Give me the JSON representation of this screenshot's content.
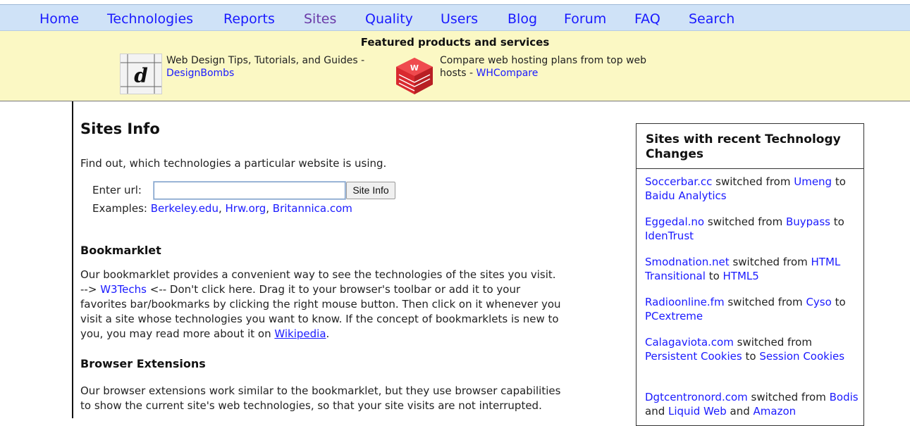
{
  "nav": {
    "items": [
      {
        "label": "Home",
        "active": false
      },
      {
        "label": "Technologies",
        "active": false
      },
      {
        "label": "Reports",
        "active": false
      },
      {
        "label": "Sites",
        "active": true
      },
      {
        "label": "Quality",
        "active": false
      },
      {
        "label": "Users",
        "active": false
      },
      {
        "label": "Blog",
        "active": false
      },
      {
        "label": "Forum",
        "active": false
      },
      {
        "label": "FAQ",
        "active": false
      },
      {
        "label": "Search",
        "active": false
      }
    ]
  },
  "featured": {
    "title": "Featured products and services",
    "items": [
      {
        "text": "Web Design Tips, Tutorials, and Guides -",
        "link": "DesignBombs",
        "icon": "designbombs-logo-icon"
      },
      {
        "text": "Compare web hosting plans from top web hosts -",
        "link": "WHCompare",
        "icon": "whcompare-logo-icon"
      }
    ]
  },
  "main": {
    "title": "Sites Info",
    "intro": "Find out, which technologies a particular website is using.",
    "url_label": "Enter url:",
    "url_value": "",
    "url_placeholder": "",
    "submit_label": "Site Info",
    "examples_label": "Examples:",
    "examples": [
      "Berkeley.edu",
      "Hrw.org",
      "Britannica.com"
    ],
    "bookmarklet": {
      "heading": "Bookmarklet",
      "line1": "Our bookmarklet provides a convenient way to see the technologies of the sites you visit.",
      "arrow_left": "-->",
      "link": "W3Techs",
      "text_after_link": "<-- Don't click here. Drag it to your browser's toolbar or add it to your",
      "line3": "favorites bar/bookmarks by clicking the right mouse button. Then click on it whenever you",
      "line4": "visit a site whose technologies you want to know. If the concept of bookmarklets is new to",
      "line5_pre": "you, you may read more about it on",
      "wiki_link": "Wikipedia",
      "line5_post": "."
    },
    "extensions": {
      "heading": "Browser Extensions",
      "line1": "Our browser extensions work similar to the bookmarklet, but they use browser capabilities",
      "line2": "to show the current site's web technologies, so that your site visits are not interrupted."
    }
  },
  "sidebar": {
    "title": "Sites with recent Technology Changes",
    "changes": [
      {
        "site": "Soccerbar.cc",
        "verb": "switched from",
        "from": "Umeng",
        "to_word": "to",
        "to": "Baidu Analytics"
      },
      {
        "site": "Eggedal.no",
        "verb": "switched from",
        "from": "Buypass",
        "to_word": "to",
        "to": "IdenTrust"
      },
      {
        "site": "Smodnation.net",
        "verb": "switched from",
        "from": "HTML Transitional",
        "to_word": "to",
        "to": "HTML5"
      },
      {
        "site": "Radioonline.fm",
        "verb": "switched from",
        "from": "Cyso",
        "to_word": "to",
        "to": "PCextreme"
      },
      {
        "site": "Calagaviota.com",
        "verb": "switched from",
        "from": "Persistent Cookies",
        "to_word": "to",
        "to": "Session Cookies"
      },
      {
        "site": "Dgtcentronord.com",
        "verb": "switched from",
        "from": "Bodis",
        "and1": "and",
        "from2": "Liquid Web",
        "and2": "and",
        "from3": "Amazon"
      }
    ]
  },
  "colors": {
    "nav_bg": "#cfe2f7",
    "link": "#1a1aff",
    "active_nav": "#6a3aa8",
    "featured_bg": "#fbf8c4",
    "whcompare_red": "#d9292f"
  }
}
